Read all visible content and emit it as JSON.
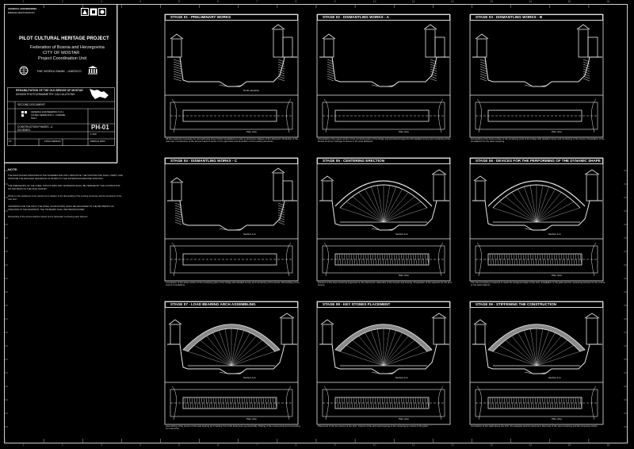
{
  "title_block": {
    "logo_top_1": "GENERAL ENGINEERING",
    "logo_top_2": "BRIDGE RESTORATION",
    "project_title": "PILOT CULTURAL HERITAGE PROJECT",
    "federation": "Federation of Bosnia and Herzegovina",
    "city": "CITY OF MOSTAR",
    "unit": "Project Coordination Unit",
    "sponsors": "THE WORLD BANK - UNESCO",
    "work_title_1": "REHABILITATION OF THE OLD BRIDGE OF MOSTAR",
    "work_title_2": "DESIGN PHOTOGRAMMETRY CALCULATIONS",
    "document": "SECOND DOCUMENT",
    "designer_1": "GENERAL ENGINEERING S.R.L.",
    "designer_2": "VIA DEI CERRETANI 1 - FIRENZE",
    "designer_3": "ITALY",
    "drawing_name": "CONSTRUCTION PHASES - A",
    "drawing_sub": "SCHEMES",
    "drawing_no": "PH-01",
    "scale_label": "1:100",
    "status": "FINAL DESIGN",
    "date": "MARCH 2004",
    "row_label": "16"
  },
  "notes": {
    "heading": "NOTE:",
    "paragraphs": [
      "THE MAIN PHASES INDICATED IN THE SCHEMES ARE ONLY INDICATIVE. THE CONTRACTOR SHALL VERIFY AND PROPOSE THE DETAILED SEQUENCE OF WORKS TO THE SUPERVISION BEFORE STARTING",
      "THE DIMENSIONS OF THE STEEL STRUCTURES AND CENTERING SHALL BE VERIFIED BY THE CONTRACTOR ON THE BASIS OF THE FINAL SURVEY",
      "Works on the cantilevers to be carried out in relation to the dismantling of the existing structures and the protection of the river bed",
      "CENTERING FOR THE ARCH: THE STEEL SCAFFOLDING SHALL BE ANCHORED TO THE ABUTMENTS AS INDICATED IN THE DRAWINGS. THE TIE BEAMS SHALL BE PRETENSIONED",
      "Dismantling of the stones shall be carried out by hand after numbering each element"
    ]
  },
  "panels": [
    {
      "title": "STAGE 01 - PRELIMINARY WORKS",
      "label_a": "North elevation",
      "label_b": "Plan view",
      "caption": "All the measures necessary for strengthening stone blocks foundations in order to avoid any collapse of the abutment. Protection of the river bed. Construction of the access road for works on the right bank and demolition of the existing structures."
    },
    {
      "title": "STAGE 02 - DISMANTLING WORKS - A",
      "label_a": "",
      "label_b": "Plan view",
      "caption": "Dismantling of the upper portion of the remaining parts of the bridge and provisional supports with detailed survey and numbering of the blocks removed. Storage of stones in the area assigned."
    },
    {
      "title": "STAGE 03 - DISMANTLING WORKS - B",
      "label_a": "",
      "label_b": "Plan view",
      "caption": "Dismantling of the lower portion of the remaining parts of the bridge with detailed survey and numbering of the stones. Preparation of the foundations for the steel centering."
    },
    {
      "title": "STAGE 04 - DISMANTLING WORKS - C",
      "label_a": "Section A-A",
      "label_b": "",
      "caption": "Completion of the lower portion of the remaining parts of the bridge with detailed survey and numbering of the stones. Dismantling of the towers' foundations."
    },
    {
      "title": "STAGE 05 - CENTERING ERECTION",
      "label_a": "Section A-A",
      "label_b": "Plan view",
      "caption": "Erection of the steel centering supported on the abutments. Assembly of the trusses and bracing. Preparation of the supports for the arch stones."
    },
    {
      "title": "STAGE 06 - DEVICES FOR THE PERFORMING OF THE DYNAMIC SHAPE",
      "label_a": "Section A-A",
      "label_b": "Plan view",
      "caption": "The steel centering is lowered to reach the designed shape of the arch. Installation of the jacks and the measuring devices for the control of the deformations."
    },
    {
      "title": "STAGE 07 - LOAD BEARING ARCH ASSEMBLING",
      "label_a": "Section A-A",
      "label_b": "Plan view",
      "caption": "Assembling of the stones of the load bearing arch starting from both abutments symmetrically. Placing of the mortar joints and connecting iron elements."
    },
    {
      "title": "STAGE 08 - KEY STONES PLACEMENT",
      "label_a": "Section A-A",
      "label_b": "Plan view",
      "caption": "Placement of the key stones of the arch. Closure of the arch and lowering of the centering by means of the jacks."
    },
    {
      "title": "STAGE 09 - STIFFENING THE CONSTRUCTION",
      "label_a": "Section A-A",
      "label_b": "Plan view",
      "caption": "Completion of the walls above the arch, the parapets and the pavement. Removal of the steel centering and the temporary works."
    }
  ],
  "ruler_numbers": [
    "1",
    "2",
    "3",
    "4",
    "5",
    "6",
    "7",
    "8",
    "9",
    "10",
    "11",
    "12",
    "13",
    "14",
    "15",
    "16"
  ]
}
